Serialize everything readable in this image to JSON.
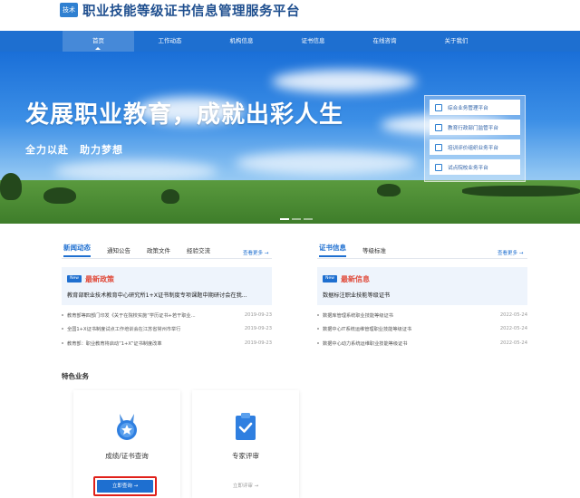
{
  "header": {
    "logo_text": "技术",
    "site_title": "职业技能等级证书信息管理服务平台"
  },
  "nav": {
    "items": [
      {
        "label": "首页",
        "active": true
      },
      {
        "label": "工作动态"
      },
      {
        "label": "机构信息"
      },
      {
        "label": "证书信息"
      },
      {
        "label": "在线咨询"
      },
      {
        "label": "关于我们"
      }
    ]
  },
  "banner": {
    "title": "发展职业教育，成就出彩人生",
    "subtitle": "全力以赴　助力梦想",
    "quick_links": [
      {
        "label": "综合业务管理平台",
        "icon": "grid-icon"
      },
      {
        "label": "教育行政部门监管平台",
        "icon": "building-icon"
      },
      {
        "label": "培训评价组织业务平台",
        "icon": "document-icon"
      },
      {
        "label": "试点院校业务平台",
        "icon": "school-icon"
      }
    ],
    "carousel_active": 0
  },
  "news": {
    "tabs": [
      "新闻动态",
      "通知公告",
      "政策文件",
      "经验交流"
    ],
    "more": "查看更多 →",
    "feature_badge": "New",
    "feature_label": "最新政策",
    "feature_text": "教育部职业技术教育中心研究所1+X证书制度专项课题中期研讨会在我...",
    "items": [
      {
        "title": "教育部等四部门印发《关于在院校实施“学历证书+若干职业...",
        "date": "2019-09-23"
      },
      {
        "title": "全国1+X证书制度试点工作培训会在江苏省常州市举行",
        "date": "2019-09-23"
      },
      {
        "title": "教育部：职业教育将启动“1+X”证书制度改革",
        "date": "2019-09-23"
      }
    ]
  },
  "certs": {
    "tabs": [
      "证书信息",
      "等级标准"
    ],
    "more": "查看更多 →",
    "feature_badge": "New",
    "feature_label": "最新信息",
    "feature_text": "数据标注职业技能等级证书",
    "items": [
      {
        "title": "数据库管理系统职业技能等级证书",
        "date": "2022-05-24"
      },
      {
        "title": "数据中心IT系统运维管理职业技能等级证书",
        "date": "2022-05-24"
      },
      {
        "title": "数据中心动力系统运维职业技能等级证书",
        "date": "2022-05-24"
      }
    ]
  },
  "services": {
    "section_title": "特色业务",
    "cards": [
      {
        "name": "成绩/证书查询",
        "button": "立即查询 →",
        "icon": "medal-icon"
      },
      {
        "name": "专家评审",
        "link": "立即评审 →",
        "icon": "clipboard-check-icon"
      }
    ]
  },
  "colors": {
    "primary": "#1e6fd0",
    "highlight": "#e0201a",
    "title": "#1f4f8f"
  }
}
